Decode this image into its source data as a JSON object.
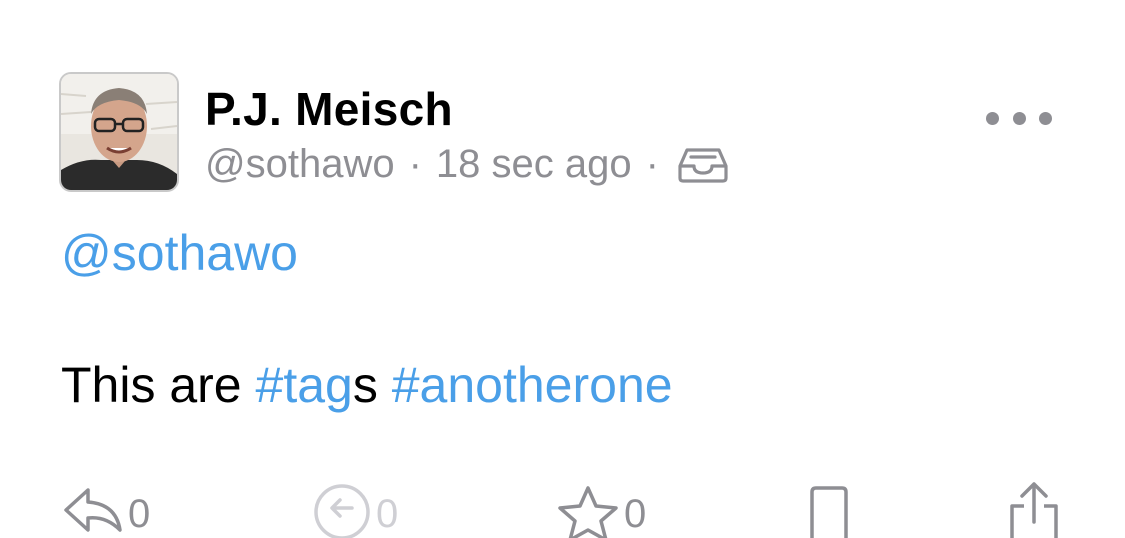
{
  "post": {
    "display_name": "P.J. Meisch",
    "handle": "@sothawo",
    "separator": "·",
    "time_ago": "18 sec ago",
    "visibility_icon": "tray-icon",
    "more_icon": "ellipsis-icon",
    "mention": "@sothawo",
    "text_prefix": "This are ",
    "tag_one": "#tag",
    "tag_one_suffix": "s",
    "text_space": " ",
    "tag_two": "#anotherone"
  },
  "colors": {
    "link": "#4a9fe8",
    "secondary": "#8e8e93",
    "text": "#000000"
  },
  "actions": {
    "reply": {
      "icon": "reply-icon",
      "count": "0"
    },
    "boost": {
      "icon": "boost-icon",
      "count": "0"
    },
    "favourite": {
      "icon": "star-icon",
      "count": "0"
    },
    "bookmark": {
      "icon": "bookmark-icon"
    },
    "share": {
      "icon": "share-icon"
    }
  }
}
